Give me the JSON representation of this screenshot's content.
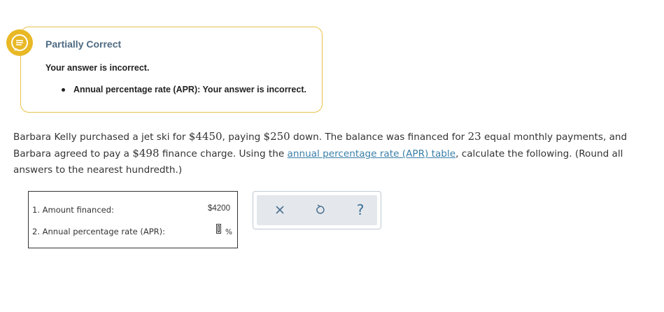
{
  "feedback": {
    "title": "Partially Correct",
    "message": "Your answer is incorrect.",
    "bullets": [
      "Annual percentage rate (APR): Your answer is incorrect."
    ],
    "accent_color": "#e8b825",
    "title_color": "#4e6a82",
    "icon": "speech-bubble-icon"
  },
  "problem": {
    "part1": "Barbara Kelly purchased a jet ski for ",
    "price": "$4450",
    "part2": ", paying ",
    "down": "$250",
    "part3": " down. The balance was financed for ",
    "payments": "23",
    "part4": " equal monthly payments, and Barbara agreed to pay a ",
    "finance_charge": "$498",
    "part5": " finance charge. Using the ",
    "link_text": "annual percentage rate (APR) table",
    "part6": ", calculate the following. (Round all answers to the nearest hundredth.)",
    "link_color": "#3a7fa8"
  },
  "answers": {
    "rows": [
      {
        "label": "1. Amount financed:",
        "value": "$4200"
      },
      {
        "label": "2. Annual percentage rate (APR):",
        "value": "",
        "unit": "%"
      }
    ]
  },
  "tools": {
    "clear": "close-icon",
    "reset": "undo-icon",
    "help_label": "?"
  }
}
